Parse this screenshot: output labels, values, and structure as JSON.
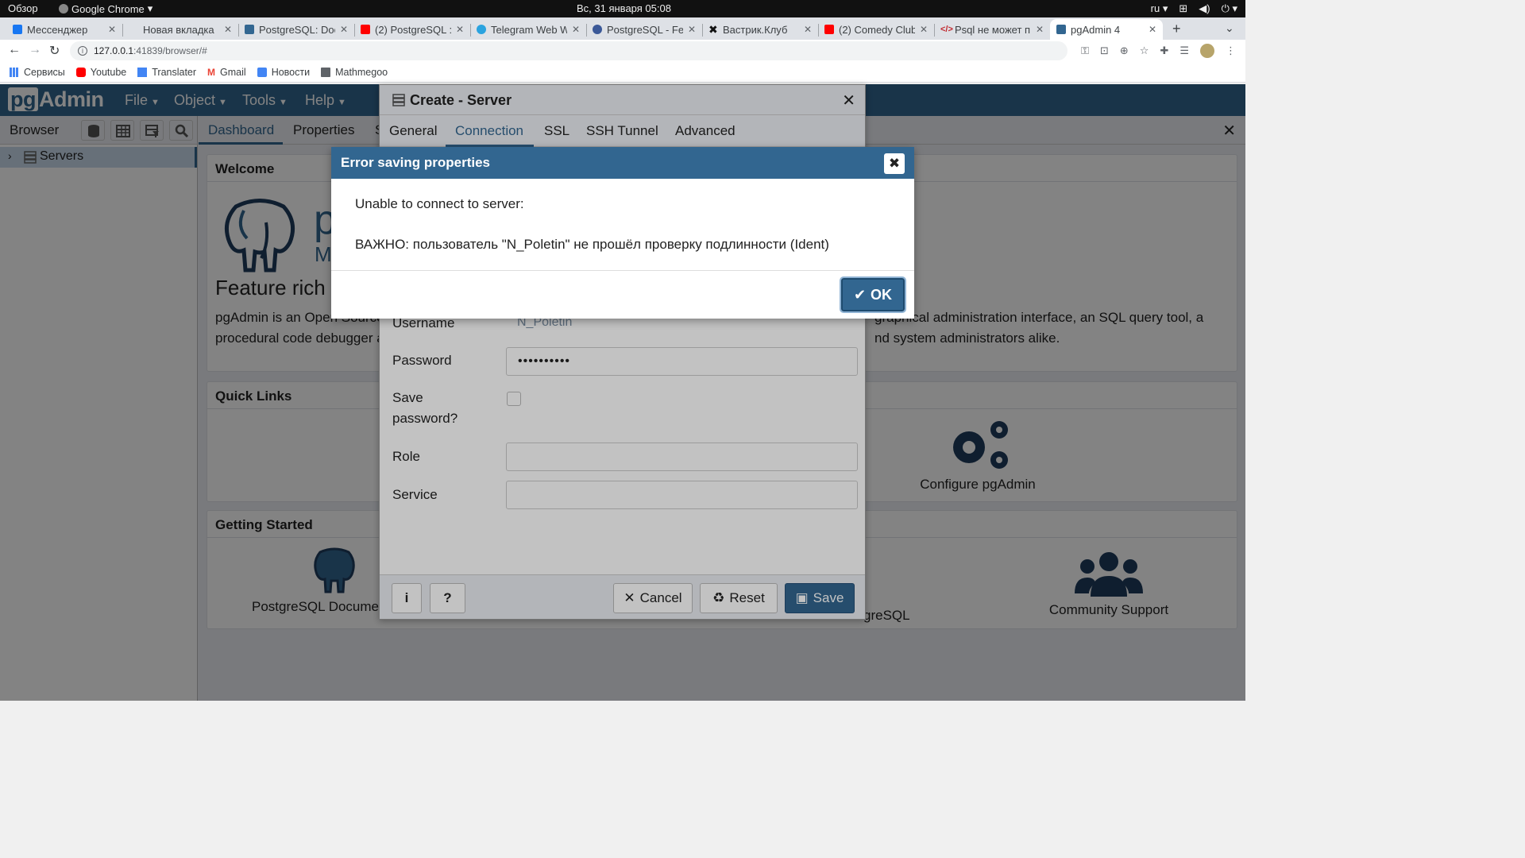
{
  "gnome": {
    "activities": "Обзор",
    "app_name": "Google Chrome",
    "clock": "Вс, 31 января  05:08",
    "lang": "ru"
  },
  "tabs": [
    {
      "title": "Мессенджер",
      "color": "#1877f2"
    },
    {
      "title": "Новая вкладка",
      "color": "#dee1e6"
    },
    {
      "title": "PostgreSQL: Doc",
      "color": "#336791"
    },
    {
      "title": "(2) PostgreSQL : ",
      "color": "#ff0000"
    },
    {
      "title": "Telegram Web W",
      "color": "#2aa3df"
    },
    {
      "title": "PostgreSQL - Fed",
      "color": "#3b5998"
    },
    {
      "title": "Вастрик.Клуб",
      "color": "#111111"
    },
    {
      "title": "(2) Comedy Club",
      "color": "#ff0000"
    },
    {
      "title": "Psql не может п",
      "color": "#c1272d"
    },
    {
      "title": "pgAdmin 4",
      "color": "#326690"
    }
  ],
  "omnibox": {
    "host": "127.0.0.1",
    "path": ":41839/browser/#"
  },
  "bookmarks": [
    {
      "label": "Сервисы",
      "color": "#4285f4"
    },
    {
      "label": "Youtube",
      "color": "#ff0000"
    },
    {
      "label": "Translater",
      "color": "#4285f4"
    },
    {
      "label": "Gmail",
      "color": "#ea4335"
    },
    {
      "label": "Новости",
      "color": "#4285f4"
    },
    {
      "label": "Mathmegoo",
      "color": "#5f6368"
    }
  ],
  "pgadmin": {
    "logo_pg": "pg",
    "logo_admin": "Admin",
    "menu": [
      "File",
      "Object",
      "Tools",
      "Help"
    ],
    "browser_label": "Browser",
    "tree_item": "Servers",
    "dash_tabs": [
      "Dashboard",
      "Properties",
      "S"
    ],
    "welcome_head": "Welcome",
    "welcome_big": "p",
    "welcome_sub": "M",
    "feature_rich": "Feature rich |",
    "welcome_text_left": "pgAdmin is an Open Source",
    "welcome_text_left2": "procedural code debugger a",
    "welcome_text_right": "graphical administration interface, an SQL query tool, a",
    "welcome_text_right2": "nd system administrators alike.",
    "quick_links_head": "Quick Links",
    "configure": "Configure pgAdmin",
    "getting_started_head": "Getting Started",
    "pg_docs": "PostgreSQL Documen",
    "pg_site": "greSQL",
    "community": "Community Support"
  },
  "create_server": {
    "title": "Create - Server",
    "tabs": [
      "General",
      "Connection",
      "SSL",
      "SSH Tunnel",
      "Advanced"
    ],
    "username_label": "Username",
    "username_value": "N_Poletin",
    "password_label": "Password",
    "password_value": "••••••••••",
    "save_password_label": "Save password?",
    "role_label": "Role",
    "service_label": "Service",
    "info_btn": "i",
    "help_btn": "?",
    "cancel": "Cancel",
    "reset": "Reset",
    "save": "Save"
  },
  "error": {
    "title": "Error saving properties",
    "line1": "Unable to connect to server:",
    "line2": "ВАЖНО:  пользователь \"N_Poletin\" не прошёл проверку подлинности (Ident)",
    "ok": "OK"
  }
}
